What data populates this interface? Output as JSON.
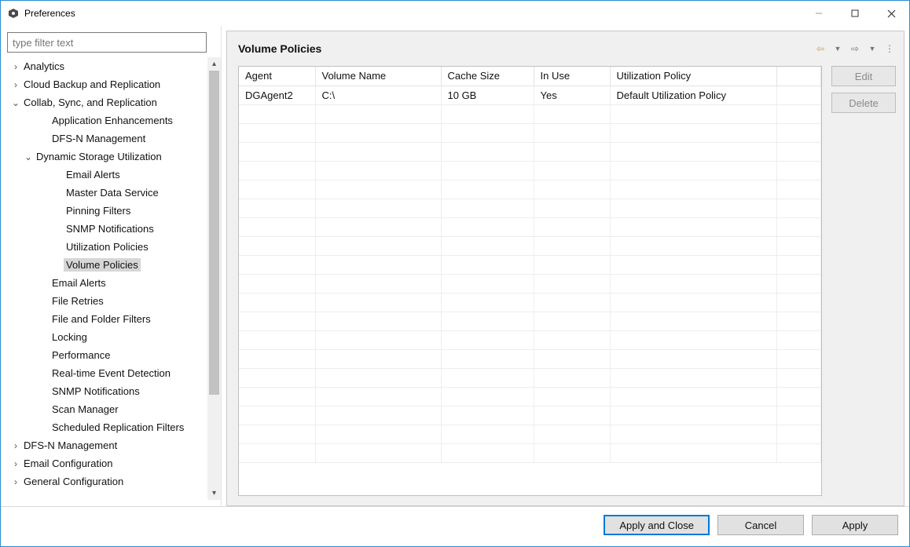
{
  "window": {
    "title": "Preferences"
  },
  "filter": {
    "placeholder": "type filter text"
  },
  "tree": {
    "analytics": "Analytics",
    "cloud_backup": "Cloud Backup and Replication",
    "collab": "Collab, Sync, and Replication",
    "app_enh": "Application Enhancements",
    "dfsn_mgmt_a": "DFS-N Management",
    "dsu": "Dynamic Storage Utilization",
    "email_alerts_a": "Email Alerts",
    "master_data": "Master Data Service",
    "pinning": "Pinning Filters",
    "snmp_a": "SNMP Notifications",
    "util_pol": "Utilization Policies",
    "vol_pol": "Volume Policies",
    "email_alerts_b": "Email Alerts",
    "file_retries": "File Retries",
    "fff": "File and Folder Filters",
    "locking": "Locking",
    "performance": "Performance",
    "rted": "Real-time Event Detection",
    "snmp_b": "SNMP Notifications",
    "scan_mgr": "Scan Manager",
    "srf": "Scheduled Replication Filters",
    "dfsn_mgmt_b": "DFS-N Management",
    "email_cfg": "Email Configuration",
    "gen_cfg": "General Configuration"
  },
  "panel": {
    "title": "Volume Policies"
  },
  "table": {
    "headers": {
      "agent": "Agent",
      "volume": "Volume Name",
      "cache": "Cache Size",
      "inuse": "In Use",
      "policy": "Utilization Policy"
    },
    "rows": [
      {
        "agent": "DGAgent2",
        "volume": "C:\\",
        "cache": "10 GB",
        "inuse": "Yes",
        "policy": "Default Utilization Policy"
      }
    ]
  },
  "buttons": {
    "edit": "Edit",
    "delete": "Delete",
    "apply_close": "Apply and Close",
    "cancel": "Cancel",
    "apply": "Apply"
  }
}
